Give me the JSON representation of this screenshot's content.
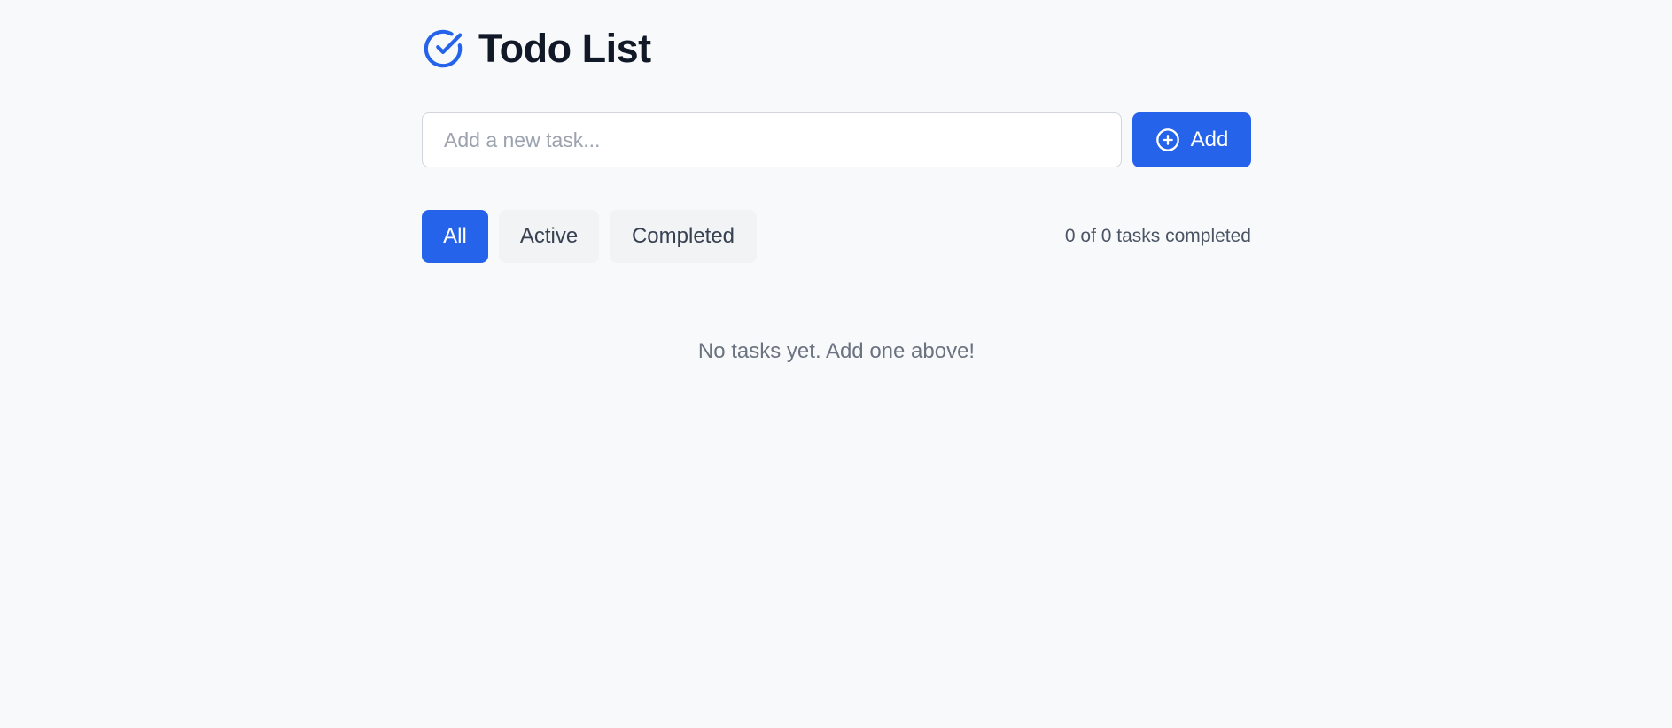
{
  "header": {
    "title": "Todo List",
    "icon": "check-circle-icon",
    "icon_color": "#2563eb"
  },
  "add_task": {
    "placeholder": "Add a new task...",
    "value": "",
    "button_label": "Add",
    "button_icon": "plus-circle-icon"
  },
  "filters": {
    "all_label": "All",
    "active_label": "Active",
    "completed_label": "Completed",
    "selected": "All"
  },
  "counter": {
    "text": "0 of 0 tasks completed"
  },
  "tasks": [],
  "empty_state": {
    "message": "No tasks yet. Add one above!"
  },
  "colors": {
    "accent": "#2563eb",
    "background": "#f8f9fb"
  }
}
